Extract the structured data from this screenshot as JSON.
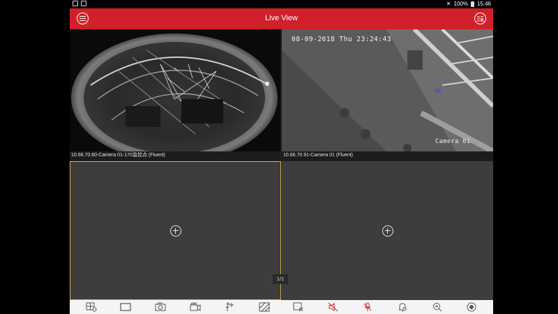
{
  "statusbar": {
    "battery": "100%",
    "time": "15:46"
  },
  "header": {
    "title": "Live View"
  },
  "tiles": [
    {
      "caption": "10.66.70.60-Camera 01-170监控点 (Fluent)"
    },
    {
      "caption": "10.66.70.91-Camera 01 (Fluent)",
      "osd_datetime": "08-09-2018 Thu 23:24:43",
      "osd_name": "Camera 01"
    }
  ],
  "pager": {
    "label": "1/1"
  },
  "toolbar": {
    "icons": [
      "split-screen-icon",
      "single-window-icon",
      "capture-icon",
      "record-icon",
      "ptz-icon",
      "image-quality-icon",
      "stop-all-icon",
      "audio-icon",
      "two-way-audio-icon",
      "alarm-output-icon",
      "digital-zoom-icon",
      "fisheye-icon"
    ],
    "accent": "#d0202a"
  },
  "colors": {
    "header": "#d0202a",
    "selected_border": "#d6b84a"
  }
}
